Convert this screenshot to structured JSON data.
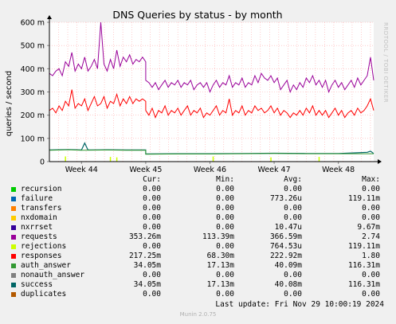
{
  "chart_data": {
    "type": "line",
    "title": "DNS Queries by status - by month",
    "ylabel": "queries / second",
    "ylim": [
      0,
      0.6
    ],
    "yticks": [
      0,
      0.1,
      0.2,
      0.3,
      0.4,
      0.5,
      0.6
    ],
    "yticklabels": [
      "0",
      "100 m",
      "200 m",
      "300 m",
      "400 m",
      "500 m",
      "600 m"
    ],
    "xlim": [
      0,
      5.05
    ],
    "x_ticks": [
      {
        "pos": 0.5,
        "label": "Week 44"
      },
      {
        "pos": 1.5,
        "label": "Week 45"
      },
      {
        "pos": 2.5,
        "label": "Week 46"
      },
      {
        "pos": 3.5,
        "label": "Week 47"
      },
      {
        "pos": 4.5,
        "label": "Week 48"
      }
    ],
    "grid": true,
    "series": [
      {
        "name": "requests",
        "color": "#990099",
        "width": 1,
        "values": [
          [
            0.0,
            0.38
          ],
          [
            0.05,
            0.37
          ],
          [
            0.1,
            0.39
          ],
          [
            0.15,
            0.4
          ],
          [
            0.2,
            0.37
          ],
          [
            0.25,
            0.43
          ],
          [
            0.3,
            0.41
          ],
          [
            0.35,
            0.47
          ],
          [
            0.4,
            0.39
          ],
          [
            0.45,
            0.42
          ],
          [
            0.5,
            0.4
          ],
          [
            0.55,
            0.45
          ],
          [
            0.6,
            0.39
          ],
          [
            0.65,
            0.41
          ],
          [
            0.7,
            0.44
          ],
          [
            0.75,
            0.4
          ],
          [
            0.8,
            0.6
          ],
          [
            0.85,
            0.42
          ],
          [
            0.9,
            0.39
          ],
          [
            0.95,
            0.44
          ],
          [
            1.0,
            0.4
          ],
          [
            1.05,
            0.48
          ],
          [
            1.1,
            0.41
          ],
          [
            1.15,
            0.45
          ],
          [
            1.2,
            0.43
          ],
          [
            1.25,
            0.46
          ],
          [
            1.3,
            0.42
          ],
          [
            1.35,
            0.44
          ],
          [
            1.4,
            0.43
          ],
          [
            1.45,
            0.45
          ],
          [
            1.5,
            0.43
          ],
          [
            1.5,
            0.35
          ],
          [
            1.55,
            0.34
          ],
          [
            1.6,
            0.32
          ],
          [
            1.65,
            0.34
          ],
          [
            1.7,
            0.31
          ],
          [
            1.75,
            0.33
          ],
          [
            1.8,
            0.35
          ],
          [
            1.85,
            0.32
          ],
          [
            1.9,
            0.34
          ],
          [
            1.95,
            0.33
          ],
          [
            2.0,
            0.35
          ],
          [
            2.05,
            0.32
          ],
          [
            2.1,
            0.34
          ],
          [
            2.15,
            0.33
          ],
          [
            2.2,
            0.35
          ],
          [
            2.25,
            0.31
          ],
          [
            2.3,
            0.33
          ],
          [
            2.35,
            0.34
          ],
          [
            2.4,
            0.32
          ],
          [
            2.45,
            0.34
          ],
          [
            2.5,
            0.3
          ],
          [
            2.55,
            0.33
          ],
          [
            2.6,
            0.35
          ],
          [
            2.65,
            0.32
          ],
          [
            2.7,
            0.34
          ],
          [
            2.75,
            0.33
          ],
          [
            2.8,
            0.37
          ],
          [
            2.85,
            0.32
          ],
          [
            2.9,
            0.34
          ],
          [
            2.95,
            0.33
          ],
          [
            3.0,
            0.36
          ],
          [
            3.05,
            0.32
          ],
          [
            3.1,
            0.34
          ],
          [
            3.15,
            0.33
          ],
          [
            3.2,
            0.37
          ],
          [
            3.25,
            0.34
          ],
          [
            3.3,
            0.38
          ],
          [
            3.35,
            0.36
          ],
          [
            3.4,
            0.35
          ],
          [
            3.45,
            0.37
          ],
          [
            3.5,
            0.34
          ],
          [
            3.55,
            0.36
          ],
          [
            3.6,
            0.31
          ],
          [
            3.65,
            0.33
          ],
          [
            3.7,
            0.35
          ],
          [
            3.75,
            0.3
          ],
          [
            3.8,
            0.33
          ],
          [
            3.85,
            0.31
          ],
          [
            3.9,
            0.34
          ],
          [
            3.95,
            0.32
          ],
          [
            4.0,
            0.36
          ],
          [
            4.05,
            0.34
          ],
          [
            4.1,
            0.37
          ],
          [
            4.15,
            0.33
          ],
          [
            4.2,
            0.35
          ],
          [
            4.25,
            0.32
          ],
          [
            4.3,
            0.35
          ],
          [
            4.35,
            0.3
          ],
          [
            4.4,
            0.33
          ],
          [
            4.45,
            0.35
          ],
          [
            4.5,
            0.32
          ],
          [
            4.55,
            0.34
          ],
          [
            4.6,
            0.31
          ],
          [
            4.65,
            0.33
          ],
          [
            4.7,
            0.35
          ],
          [
            4.75,
            0.32
          ],
          [
            4.8,
            0.36
          ],
          [
            4.85,
            0.33
          ],
          [
            4.9,
            0.35
          ],
          [
            4.95,
            0.37
          ],
          [
            5.0,
            0.45
          ],
          [
            5.05,
            0.35
          ]
        ]
      },
      {
        "name": "responses",
        "color": "#FF0000",
        "width": 1,
        "values": [
          [
            0.0,
            0.22
          ],
          [
            0.05,
            0.23
          ],
          [
            0.1,
            0.21
          ],
          [
            0.15,
            0.24
          ],
          [
            0.2,
            0.22
          ],
          [
            0.25,
            0.26
          ],
          [
            0.3,
            0.24
          ],
          [
            0.35,
            0.31
          ],
          [
            0.4,
            0.23
          ],
          [
            0.45,
            0.25
          ],
          [
            0.5,
            0.24
          ],
          [
            0.55,
            0.27
          ],
          [
            0.6,
            0.22
          ],
          [
            0.65,
            0.25
          ],
          [
            0.7,
            0.28
          ],
          [
            0.75,
            0.24
          ],
          [
            0.8,
            0.25
          ],
          [
            0.85,
            0.28
          ],
          [
            0.9,
            0.23
          ],
          [
            0.95,
            0.26
          ],
          [
            1.0,
            0.25
          ],
          [
            1.05,
            0.29
          ],
          [
            1.1,
            0.24
          ],
          [
            1.15,
            0.27
          ],
          [
            1.2,
            0.25
          ],
          [
            1.25,
            0.28
          ],
          [
            1.3,
            0.25
          ],
          [
            1.35,
            0.27
          ],
          [
            1.4,
            0.26
          ],
          [
            1.45,
            0.27
          ],
          [
            1.5,
            0.26
          ],
          [
            1.5,
            0.22
          ],
          [
            1.55,
            0.2
          ],
          [
            1.6,
            0.23
          ],
          [
            1.65,
            0.19
          ],
          [
            1.7,
            0.22
          ],
          [
            1.75,
            0.21
          ],
          [
            1.8,
            0.24
          ],
          [
            1.85,
            0.2
          ],
          [
            1.9,
            0.22
          ],
          [
            1.95,
            0.21
          ],
          [
            2.0,
            0.23
          ],
          [
            2.05,
            0.2
          ],
          [
            2.1,
            0.22
          ],
          [
            2.15,
            0.24
          ],
          [
            2.2,
            0.2
          ],
          [
            2.25,
            0.22
          ],
          [
            2.3,
            0.21
          ],
          [
            2.35,
            0.23
          ],
          [
            2.4,
            0.19
          ],
          [
            2.45,
            0.21
          ],
          [
            2.5,
            0.2
          ],
          [
            2.55,
            0.22
          ],
          [
            2.6,
            0.24
          ],
          [
            2.65,
            0.2
          ],
          [
            2.7,
            0.22
          ],
          [
            2.75,
            0.21
          ],
          [
            2.8,
            0.27
          ],
          [
            2.85,
            0.2
          ],
          [
            2.9,
            0.22
          ],
          [
            2.95,
            0.21
          ],
          [
            3.0,
            0.24
          ],
          [
            3.05,
            0.2
          ],
          [
            3.1,
            0.22
          ],
          [
            3.15,
            0.21
          ],
          [
            3.2,
            0.24
          ],
          [
            3.25,
            0.22
          ],
          [
            3.3,
            0.23
          ],
          [
            3.35,
            0.21
          ],
          [
            3.4,
            0.22
          ],
          [
            3.45,
            0.24
          ],
          [
            3.5,
            0.21
          ],
          [
            3.55,
            0.23
          ],
          [
            3.6,
            0.2
          ],
          [
            3.65,
            0.22
          ],
          [
            3.7,
            0.21
          ],
          [
            3.75,
            0.19
          ],
          [
            3.8,
            0.21
          ],
          [
            3.85,
            0.2
          ],
          [
            3.9,
            0.22
          ],
          [
            3.95,
            0.2
          ],
          [
            4.0,
            0.23
          ],
          [
            4.05,
            0.21
          ],
          [
            4.1,
            0.24
          ],
          [
            4.15,
            0.2
          ],
          [
            4.2,
            0.22
          ],
          [
            4.25,
            0.2
          ],
          [
            4.3,
            0.22
          ],
          [
            4.35,
            0.19
          ],
          [
            4.4,
            0.21
          ],
          [
            4.45,
            0.23
          ],
          [
            4.5,
            0.2
          ],
          [
            4.55,
            0.22
          ],
          [
            4.6,
            0.19
          ],
          [
            4.65,
            0.21
          ],
          [
            4.7,
            0.22
          ],
          [
            4.75,
            0.2
          ],
          [
            4.8,
            0.23
          ],
          [
            4.85,
            0.21
          ],
          [
            4.9,
            0.22
          ],
          [
            4.95,
            0.24
          ],
          [
            5.0,
            0.27
          ],
          [
            5.05,
            0.22
          ]
        ]
      },
      {
        "name": "success",
        "color": "#006666",
        "width": 1.2,
        "values": [
          [
            0.0,
            0.05
          ],
          [
            0.3,
            0.052
          ],
          [
            0.5,
            0.05
          ],
          [
            0.55,
            0.08
          ],
          [
            0.6,
            0.05
          ],
          [
            0.9,
            0.051
          ],
          [
            1.2,
            0.05
          ],
          [
            1.5,
            0.05
          ],
          [
            1.5,
            0.033
          ],
          [
            2.0,
            0.034
          ],
          [
            2.5,
            0.034
          ],
          [
            3.0,
            0.035
          ],
          [
            3.5,
            0.036
          ],
          [
            4.0,
            0.035
          ],
          [
            4.5,
            0.035
          ],
          [
            4.95,
            0.04
          ],
          [
            5.0,
            0.045
          ],
          [
            5.05,
            0.035
          ]
        ]
      },
      {
        "name": "auth_answer",
        "color": "#339933",
        "width": 1,
        "values": [
          [
            0.0,
            0.049
          ],
          [
            0.3,
            0.051
          ],
          [
            0.5,
            0.049
          ],
          [
            0.9,
            0.05
          ],
          [
            1.2,
            0.049
          ],
          [
            1.5,
            0.049
          ],
          [
            1.5,
            0.032
          ],
          [
            2.0,
            0.033
          ],
          [
            2.5,
            0.033
          ],
          [
            3.0,
            0.034
          ],
          [
            3.5,
            0.035
          ],
          [
            4.0,
            0.034
          ],
          [
            4.5,
            0.034
          ],
          [
            5.05,
            0.034
          ]
        ]
      },
      {
        "name": "rejections",
        "color": "#CCFF00",
        "width": 1.5,
        "spikes": true,
        "values": [
          [
            0.25,
            0.012
          ],
          [
            0.95,
            0.01
          ],
          [
            1.05,
            0.008
          ],
          [
            2.55,
            0.012
          ],
          [
            3.45,
            0.008
          ],
          [
            4.2,
            0.01
          ]
        ]
      }
    ]
  },
  "legend": {
    "headers": {
      "cur": "Cur:",
      "min": "Min:",
      "avg": "Avg:",
      "max": "Max:"
    },
    "rows": [
      {
        "name": "recursion",
        "color": "#00CC00",
        "cur": "0.00",
        "min": "0.00",
        "avg": "0.00",
        "max": "0.00"
      },
      {
        "name": "failure",
        "color": "#0066B3",
        "cur": "0.00",
        "min": "0.00",
        "avg": "773.26u",
        "max": "119.11m"
      },
      {
        "name": "transfers",
        "color": "#FF8000",
        "cur": "0.00",
        "min": "0.00",
        "avg": "0.00",
        "max": "0.00"
      },
      {
        "name": "nxdomain",
        "color": "#FFCC00",
        "cur": "0.00",
        "min": "0.00",
        "avg": "0.00",
        "max": "0.00"
      },
      {
        "name": "nxrrset",
        "color": "#330099",
        "cur": "0.00",
        "min": "0.00",
        "avg": "10.47u",
        "max": "9.67m"
      },
      {
        "name": "requests",
        "color": "#990099",
        "cur": "353.26m",
        "min": "113.39m",
        "avg": "366.59m",
        "max": "2.74"
      },
      {
        "name": "rejections",
        "color": "#CCFF00",
        "cur": "0.00",
        "min": "0.00",
        "avg": "764.53u",
        "max": "119.11m"
      },
      {
        "name": "responses",
        "color": "#FF0000",
        "cur": "217.25m",
        "min": "68.30m",
        "avg": "222.92m",
        "max": "1.80"
      },
      {
        "name": "auth_answer",
        "color": "#339933",
        "cur": "34.05m",
        "min": "17.13m",
        "avg": "40.09m",
        "max": "116.31m"
      },
      {
        "name": "nonauth_answer",
        "color": "#808080",
        "cur": "0.00",
        "min": "0.00",
        "avg": "0.00",
        "max": "0.00"
      },
      {
        "name": "success",
        "color": "#006666",
        "cur": "34.05m",
        "min": "17.13m",
        "avg": "40.08m",
        "max": "116.31m"
      },
      {
        "name": "duplicates",
        "color": "#B35900",
        "cur": "0.00",
        "min": "0.00",
        "avg": "0.00",
        "max": "0.00"
      }
    ]
  },
  "footer": {
    "last_update": "Last update: Fri Nov 29 10:00:19 2024",
    "munin_version": "Munin 2.0.75",
    "rrdtool": "RRDTOOL / TOBI OETIKER"
  }
}
